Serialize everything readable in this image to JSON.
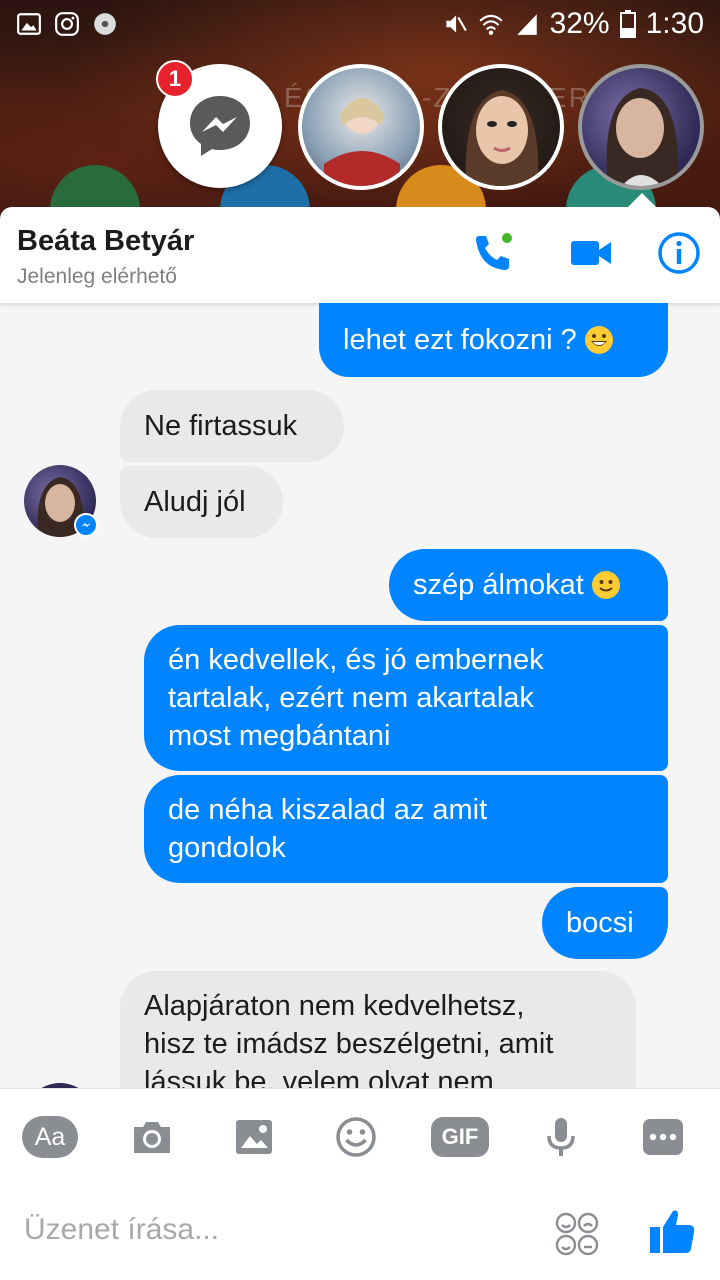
{
  "status_bar": {
    "battery": "32%",
    "time": "1:30"
  },
  "chat_heads": {
    "badge_count": "1"
  },
  "header": {
    "name": "Beáta Betyár",
    "status": "Jelenleg elérhető"
  },
  "messages": [
    {
      "text": "lehet ezt fokozni ?",
      "from": "me"
    },
    {
      "text": "Ne firtassuk",
      "from": "them"
    },
    {
      "text": "Aludj jól",
      "from": "them"
    },
    {
      "text": "szép álmokat",
      "from": "me"
    },
    {
      "text": "én kedvellek, és jó embernek",
      "from": "me"
    },
    {
      "text": "tartalak, ezért nem akartalak",
      "from": "me"
    },
    {
      "text": "most megbántani",
      "from": "me"
    },
    {
      "text": "de néha kiszalad az amit",
      "from": "me"
    },
    {
      "text": "gondolok",
      "from": "me"
    },
    {
      "text": "bocsi",
      "from": "me"
    },
    {
      "text": "Alapjáraton nem kedvelhetsz,",
      "from": "them"
    },
    {
      "text": "hisz te imádsz beszélgetni, amit",
      "from": "them"
    },
    {
      "text": "lássuk be, velem olyat nem",
      "from": "them"
    }
  ],
  "composer": {
    "aa_label": "Aa",
    "gif_label": "GIF",
    "placeholder": "Üzenet írása..."
  },
  "colors": {
    "accent": "#0084ff",
    "incoming_bubble": "#e9e9ea",
    "online_dot": "#42b72a",
    "badge": "#e8222d"
  }
}
